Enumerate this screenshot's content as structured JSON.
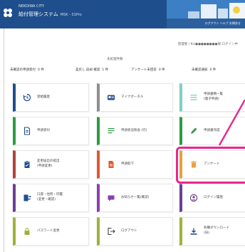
{
  "header": {
    "subtitle": "NEKOIWA CITY",
    "title": "給付管理システム",
    "env_label": "MSK - 01Pro",
    "links": "ログアウト  ヘルプ  お問合せ"
  },
  "user_line": "管理者 / Ksi●●●●●●●●様 ログイン中",
  "counts_heading": "未処理件数",
  "counts": [
    {
      "label": "未確認の申請受付",
      "count": "0 件"
    },
    {
      "label": "差戻し 返却 確認",
      "count": "1 件"
    },
    {
      "label": "アンケート未回答",
      "count": "0 件"
    },
    {
      "label": "未確認通知",
      "count": "0 件"
    }
  ],
  "tiles": [
    {
      "label": "受給履歴",
      "icon": "history-icon",
      "color": "#1f4e8c"
    },
    {
      "label": "マイナポータル",
      "icon": "card-icon",
      "color": "#8e8e8e"
    },
    {
      "label": "申請書類一覧\n(電子申請)",
      "icon": "list-icon",
      "color": "#7fd0c4"
    },
    {
      "label": "申請受付",
      "icon": "document-icon",
      "color": "#2e9a44"
    },
    {
      "label": "申請状況照会 (行)",
      "icon": "checklist-icon",
      "color": "#2e9a44"
    },
    {
      "label": "申請書作成",
      "icon": "pencil-icon",
      "color": "#2e9a44"
    },
    {
      "label": "変更届出の提出\n(申請変更)",
      "icon": "clipboard-icon",
      "color": "#b2413c"
    },
    {
      "label": "申請取下",
      "icon": "file-icon",
      "color": "#e0572c"
    },
    {
      "label": "アンケート",
      "icon": "trash-icon",
      "color": "#e8a23a"
    },
    {
      "label": "口座・住所・印鑑\n(変更・確認)",
      "icon": "transfer-icon",
      "color": "#6a3f95"
    },
    {
      "label": "お知らせ一覧(確認)",
      "icon": "chat-icon",
      "color": "#8a3fb0"
    },
    {
      "label": "ログイン履歴",
      "icon": "user-circle-icon",
      "color": "#6a3f95"
    },
    {
      "label": "パスワード変更",
      "icon": "lock-icon",
      "color": "#9fb23a"
    },
    {
      "label": "ログアウト",
      "icon": "logout-icon",
      "color": "#9fb23a"
    },
    {
      "label": "各種ダウンロード\n(旧)",
      "icon": "download-icon",
      "color": "#9fb23a"
    }
  ]
}
